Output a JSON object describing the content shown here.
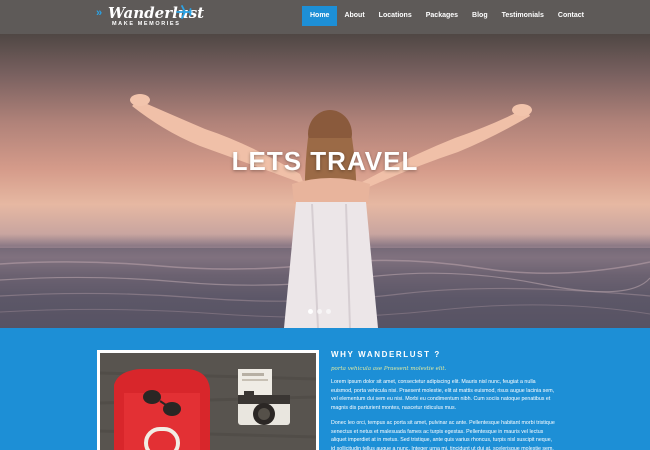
{
  "brand": {
    "title": "Wanderlust",
    "tagline": "MAKE MEMORIES",
    "chevrons": "»",
    "accent_color": "#1d8fd6"
  },
  "nav": {
    "items": [
      {
        "label": "Home",
        "active": true
      },
      {
        "label": "About"
      },
      {
        "label": "Locations"
      },
      {
        "label": "Packages"
      },
      {
        "label": "Blog"
      },
      {
        "label": "Testimonials"
      },
      {
        "label": "Contact"
      }
    ]
  },
  "hero": {
    "title": "LETS TRAVEL",
    "slides_count": 3,
    "active_slide": 1
  },
  "about": {
    "title": "WHY WANDERLUST ?",
    "subtitle": "porta vehicula ase Praesent molestie elit.",
    "paragraph1": "Lorem ipsum dolor sit amet, consectetur adipiscing elit. Mauris nisl nunc, feugiat a nulla euismod, porta vehicula nisi. Praesent molestie, elit at mattis euismod, risus augue lacinia sem, vel elementum dui sem eu nisi. Morbi eu condimentum nibh. Cum sociis natoque penatibus et magnis dis parturient montes, nascetur ridiculus mus.",
    "paragraph2": "Donec leo orci, tempus ac porta sit amet, pulvinar ac ante. Pellentesque habitant morbi tristique senectus et netus et malesuada fames ac turpis egestas. Pellentesque in mauris vel lectus aliquet imperdiet at in metus. Sed tristique, ante quis varius rhoncus, turpis nisl suscipit neque, id sollicitudin tellus augue a nunc. Integer urna mi, tincidunt ut dui at, scelerisque molestie sem."
  }
}
